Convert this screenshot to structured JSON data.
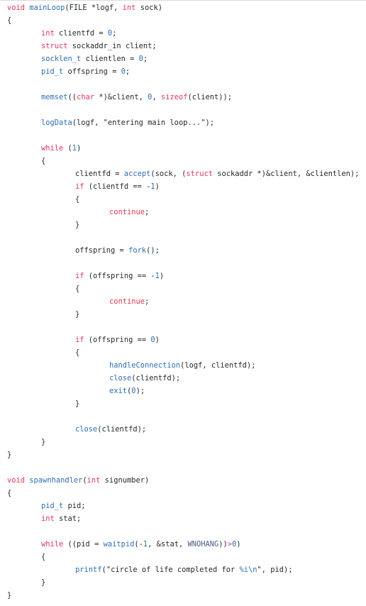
{
  "code_view": {
    "language": "c",
    "lines": [
      {
        "indent": 0,
        "tokens": [
          [
            "kw",
            "void"
          ],
          [
            "pl",
            " "
          ],
          [
            "fn",
            "mainLoop"
          ],
          [
            "pl",
            "(FILE *logf, "
          ],
          [
            "kw",
            "int"
          ],
          [
            "pl",
            " sock)"
          ]
        ]
      },
      {
        "indent": 0,
        "tokens": [
          [
            "pl",
            "{"
          ]
        ]
      },
      {
        "indent": 1,
        "tokens": [
          [
            "kw",
            "int"
          ],
          [
            "pl",
            " clientfd = "
          ],
          [
            "num",
            "0"
          ],
          [
            "pl",
            ";"
          ]
        ]
      },
      {
        "indent": 1,
        "tokens": [
          [
            "kw",
            "struct"
          ],
          [
            "pl",
            " sockaddr_in client;"
          ]
        ]
      },
      {
        "indent": 1,
        "tokens": [
          [
            "ty",
            "socklen_t"
          ],
          [
            "pl",
            " clientlen = "
          ],
          [
            "num",
            "0"
          ],
          [
            "pl",
            ";"
          ]
        ]
      },
      {
        "indent": 1,
        "tokens": [
          [
            "ty",
            "pid_t"
          ],
          [
            "pl",
            " offspring = "
          ],
          [
            "num",
            "0"
          ],
          [
            "pl",
            ";"
          ]
        ]
      },
      {
        "indent": 0,
        "tokens": []
      },
      {
        "indent": 1,
        "tokens": [
          [
            "fn",
            "memset"
          ],
          [
            "pl",
            "(("
          ],
          [
            "kw",
            "char"
          ],
          [
            "pl",
            " *)&client, "
          ],
          [
            "num",
            "0"
          ],
          [
            "pl",
            ", "
          ],
          [
            "kw",
            "sizeof"
          ],
          [
            "pl",
            "(client));"
          ]
        ]
      },
      {
        "indent": 0,
        "tokens": []
      },
      {
        "indent": 1,
        "tokens": [
          [
            "fn",
            "logData"
          ],
          [
            "pl",
            "(logf, "
          ],
          [
            "str",
            "\"entering main loop...\""
          ],
          [
            "pl",
            ");"
          ]
        ]
      },
      {
        "indent": 0,
        "tokens": []
      },
      {
        "indent": 1,
        "tokens": [
          [
            "kw",
            "while"
          ],
          [
            "pl",
            " ("
          ],
          [
            "num",
            "1"
          ],
          [
            "pl",
            ")"
          ]
        ]
      },
      {
        "indent": 1,
        "tokens": [
          [
            "pl",
            "{"
          ]
        ]
      },
      {
        "indent": 2,
        "tokens": [
          [
            "pl",
            "clientfd = "
          ],
          [
            "fn",
            "accept"
          ],
          [
            "pl",
            "(sock, ("
          ],
          [
            "kw",
            "struct"
          ],
          [
            "pl",
            " sockaddr *)&client, &clientlen);"
          ]
        ]
      },
      {
        "indent": 2,
        "tokens": [
          [
            "kw",
            "if"
          ],
          [
            "pl",
            " (clientfd == -"
          ],
          [
            "num",
            "1"
          ],
          [
            "pl",
            ")"
          ]
        ]
      },
      {
        "indent": 2,
        "tokens": [
          [
            "pl",
            "{"
          ]
        ]
      },
      {
        "indent": 3,
        "tokens": [
          [
            "kw",
            "continue"
          ],
          [
            "pl",
            ";"
          ]
        ]
      },
      {
        "indent": 2,
        "tokens": [
          [
            "pl",
            "}"
          ]
        ]
      },
      {
        "indent": 0,
        "tokens": []
      },
      {
        "indent": 2,
        "tokens": [
          [
            "pl",
            "offspring = "
          ],
          [
            "fn",
            "fork"
          ],
          [
            "pl",
            "();"
          ]
        ]
      },
      {
        "indent": 0,
        "tokens": []
      },
      {
        "indent": 2,
        "tokens": [
          [
            "kw",
            "if"
          ],
          [
            "pl",
            " (offspring == -"
          ],
          [
            "num",
            "1"
          ],
          [
            "pl",
            ")"
          ]
        ]
      },
      {
        "indent": 2,
        "tokens": [
          [
            "pl",
            "{"
          ]
        ]
      },
      {
        "indent": 3,
        "tokens": [
          [
            "kw",
            "continue"
          ],
          [
            "pl",
            ";"
          ]
        ]
      },
      {
        "indent": 2,
        "tokens": [
          [
            "pl",
            "}"
          ]
        ]
      },
      {
        "indent": 0,
        "tokens": []
      },
      {
        "indent": 2,
        "tokens": [
          [
            "kw",
            "if"
          ],
          [
            "pl",
            " (offspring == "
          ],
          [
            "num",
            "0"
          ],
          [
            "pl",
            ")"
          ]
        ]
      },
      {
        "indent": 2,
        "tokens": [
          [
            "pl",
            "{"
          ]
        ]
      },
      {
        "indent": 3,
        "tokens": [
          [
            "fn",
            "handleConnection"
          ],
          [
            "pl",
            "(logf, clientfd);"
          ]
        ]
      },
      {
        "indent": 3,
        "tokens": [
          [
            "fn",
            "close"
          ],
          [
            "pl",
            "(clientfd);"
          ]
        ]
      },
      {
        "indent": 3,
        "tokens": [
          [
            "fn",
            "exit"
          ],
          [
            "pl",
            "("
          ],
          [
            "num",
            "0"
          ],
          [
            "pl",
            ");"
          ]
        ]
      },
      {
        "indent": 2,
        "tokens": [
          [
            "pl",
            "}"
          ]
        ]
      },
      {
        "indent": 0,
        "tokens": []
      },
      {
        "indent": 2,
        "tokens": [
          [
            "fn",
            "close"
          ],
          [
            "pl",
            "(clientfd);"
          ]
        ]
      },
      {
        "indent": 1,
        "tokens": [
          [
            "pl",
            "}"
          ]
        ]
      },
      {
        "indent": 0,
        "tokens": [
          [
            "pl",
            "}"
          ]
        ]
      },
      {
        "indent": 0,
        "tokens": []
      },
      {
        "indent": 0,
        "tokens": [
          [
            "kw",
            "void"
          ],
          [
            "pl",
            " "
          ],
          [
            "fn",
            "spawnhandler"
          ],
          [
            "pl",
            "("
          ],
          [
            "kw",
            "int"
          ],
          [
            "pl",
            " signumber)"
          ]
        ]
      },
      {
        "indent": 0,
        "tokens": [
          [
            "pl",
            "{"
          ]
        ]
      },
      {
        "indent": 1,
        "tokens": [
          [
            "ty",
            "pid_t"
          ],
          [
            "pl",
            " pid;"
          ]
        ]
      },
      {
        "indent": 1,
        "tokens": [
          [
            "kw",
            "int"
          ],
          [
            "pl",
            " stat;"
          ]
        ]
      },
      {
        "indent": 0,
        "tokens": []
      },
      {
        "indent": 1,
        "tokens": [
          [
            "kw",
            "while"
          ],
          [
            "pl",
            " ((pid = "
          ],
          [
            "fn",
            "waitpid"
          ],
          [
            "pl",
            "(-"
          ],
          [
            "num",
            "1"
          ],
          [
            "pl",
            ", &stat, "
          ],
          [
            "const",
            "WNOHANG"
          ],
          [
            "pl",
            "))"
          ],
          [
            "op",
            ">"
          ],
          [
            "num",
            "0"
          ],
          [
            "pl",
            ")"
          ]
        ]
      },
      {
        "indent": 1,
        "tokens": [
          [
            "pl",
            "{"
          ]
        ]
      },
      {
        "indent": 2,
        "tokens": [
          [
            "fn",
            "printf"
          ],
          [
            "pl",
            "("
          ],
          [
            "str",
            "\"circle of life completed for "
          ],
          [
            "fmt",
            "%i\\n"
          ],
          [
            "str",
            "\""
          ],
          [
            "pl",
            ", pid);"
          ]
        ]
      },
      {
        "indent": 1,
        "tokens": [
          [
            "pl",
            "}"
          ]
        ]
      },
      {
        "indent": 0,
        "tokens": [
          [
            "pl",
            "}"
          ]
        ]
      }
    ]
  }
}
